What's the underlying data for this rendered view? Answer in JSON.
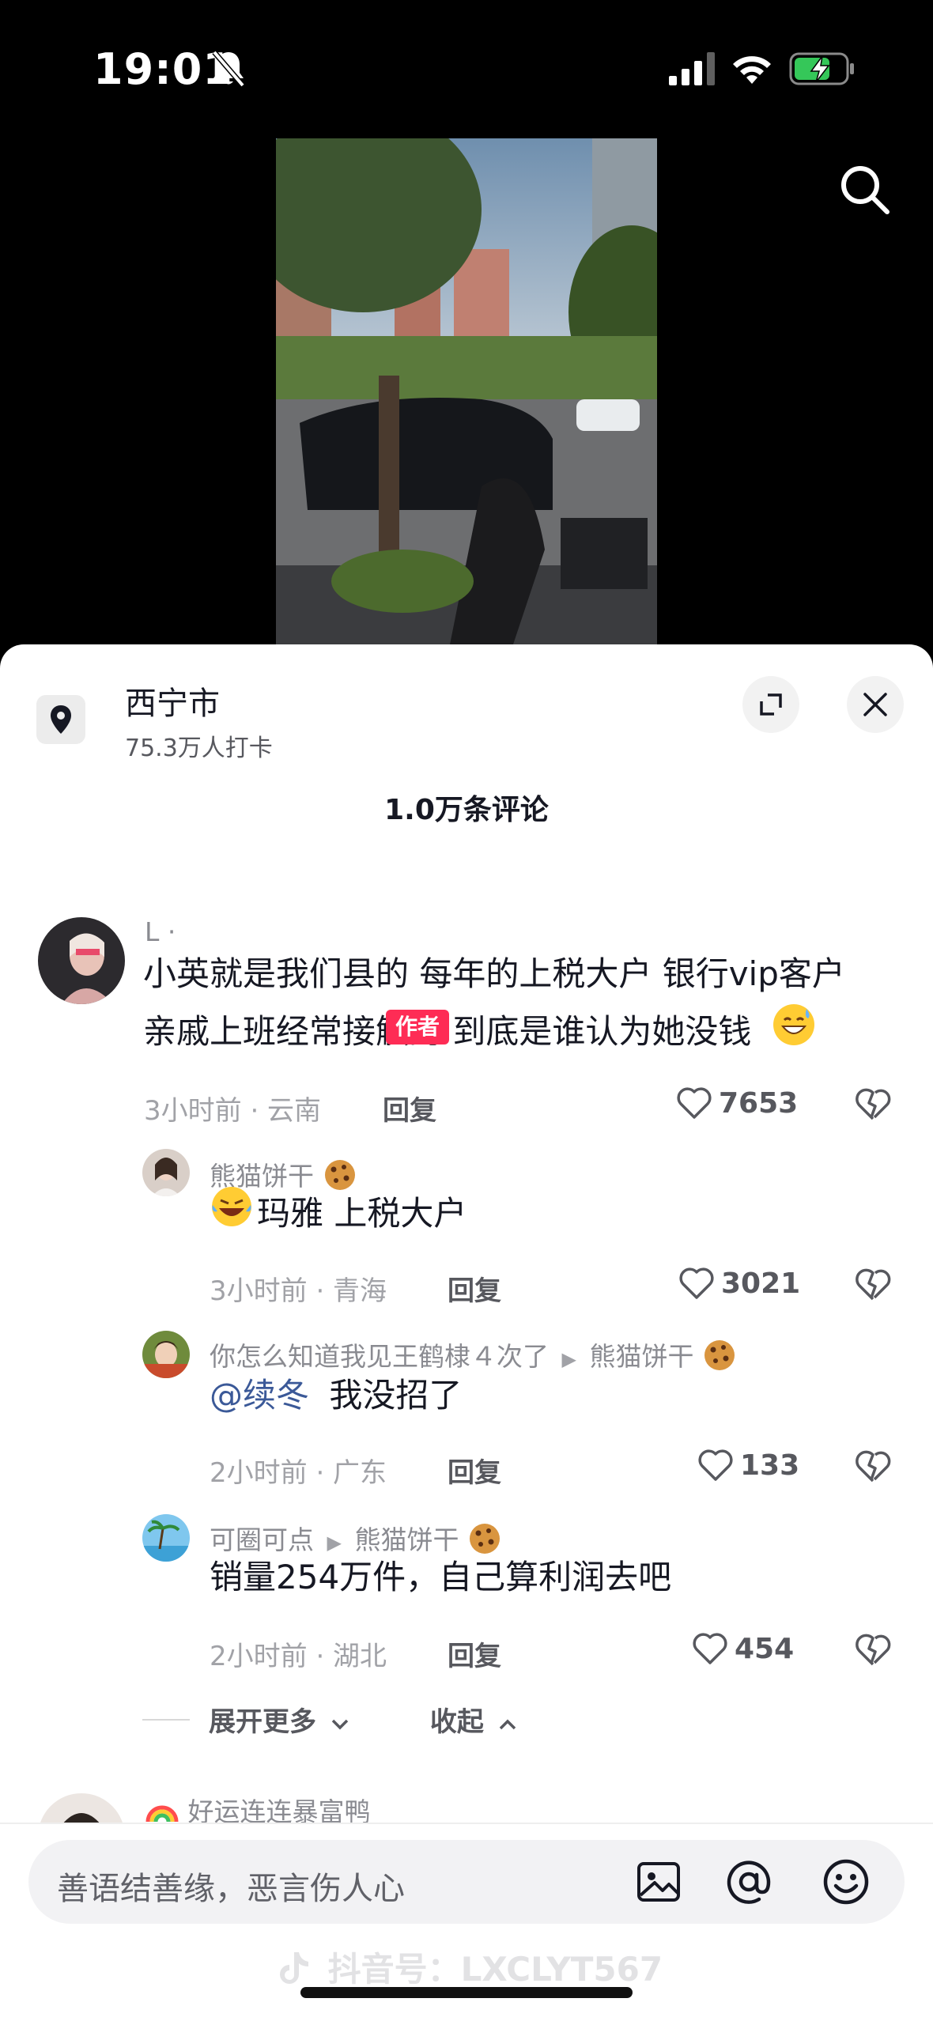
{
  "status": {
    "time": "19:01"
  },
  "location": {
    "title": "西宁市",
    "subtitle": "75.3万人打卡"
  },
  "comments_header": "1.0万条评论",
  "comments": [
    {
      "name": "L ·",
      "lines": [
        "小英就是我们县的 每年的上税大户 银行vip客户",
        "亲戚上班经常接触的 到底是谁认为她没钱"
      ],
      "meta": "3小时前 · 云南",
      "reply": "回复",
      "likes": "7653"
    },
    {
      "name": "熊猫饼干",
      "tag": "作者",
      "text": "玛雅 上税大户",
      "meta": "3小时前 · 青海",
      "reply": "回复",
      "likes": "3021"
    },
    {
      "name": "你怎么知道我见王鹤棣４次了",
      "reply_to": "熊猫饼干",
      "mention": "@续冬",
      "text": "我没招了",
      "meta": "2小时前 · 广东",
      "reply": "回复",
      "likes": "133"
    },
    {
      "name": "可圈可点",
      "reply_to": "熊猫饼干",
      "text": "销量254万件，自己算利润去吧",
      "meta": "2小时前 · 湖北",
      "reply": "回复",
      "likes": "454"
    }
  ],
  "expand_more": "展开更多",
  "collapse": "收起",
  "next_comment_name": "好运连连暴富鸭",
  "input": {
    "placeholder": "善语结善缘，恶言伤人心"
  },
  "watermark": "抖音号：LXCLYT567",
  "colors": {
    "author_tag": "#fe2c55",
    "mention": "#3b5998",
    "background": "#000000",
    "sheet": "#ffffff"
  }
}
